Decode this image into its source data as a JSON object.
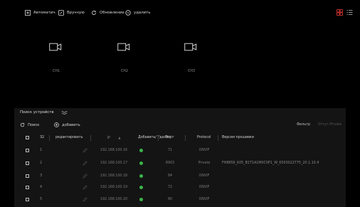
{
  "toolbar": {
    "auto_label": "Автоматич.",
    "manual_label": "Вручную",
    "refresh_label": "Обновление",
    "delete_label": "удалить"
  },
  "channels": [
    {
      "label": "CH1"
    },
    {
      "label": "CH2"
    },
    {
      "label": "CH3"
    }
  ],
  "search_panel": {
    "title": "Поиск устройств",
    "search_label": "Поиск",
    "add_label": "добавить",
    "filter_label": "Фильтр",
    "protocol_select": "Отсут.Private",
    "columns": {
      "count": "32",
      "edit": "редактировать",
      "ip": "IP",
      "status": "Добавить/ Удалит",
      "port": "Порт",
      "protocol": "Protocol",
      "firmware": "Версия прошивки"
    },
    "rows": [
      {
        "index": "1",
        "ip": "192.168.100.16",
        "port": "71",
        "protocol": "ONVIF",
        "firmware": ""
      },
      {
        "index": "2",
        "ip": "192.168.100.17",
        "port": "8903",
        "protocol": "Private",
        "firmware": "FH8856_K05_B1T1A1M0C0P1_W_K503022775_20.1.10.4"
      },
      {
        "index": "3",
        "ip": "192.168.100.18",
        "port": "84",
        "protocol": "ONVIF",
        "firmware": ""
      },
      {
        "index": "4",
        "ip": "192.168.100.19",
        "port": "72",
        "protocol": "ONVIF",
        "firmware": ""
      },
      {
        "index": "5",
        "ip": "192.168.100.20",
        "port": "80",
        "protocol": "ONVIF",
        "firmware": ""
      }
    ]
  },
  "colors": {
    "accent_red": "#e53935",
    "status_green": "#3ab54a",
    "panel_bg": "#141414",
    "divider_blue": "#1f3f55"
  }
}
